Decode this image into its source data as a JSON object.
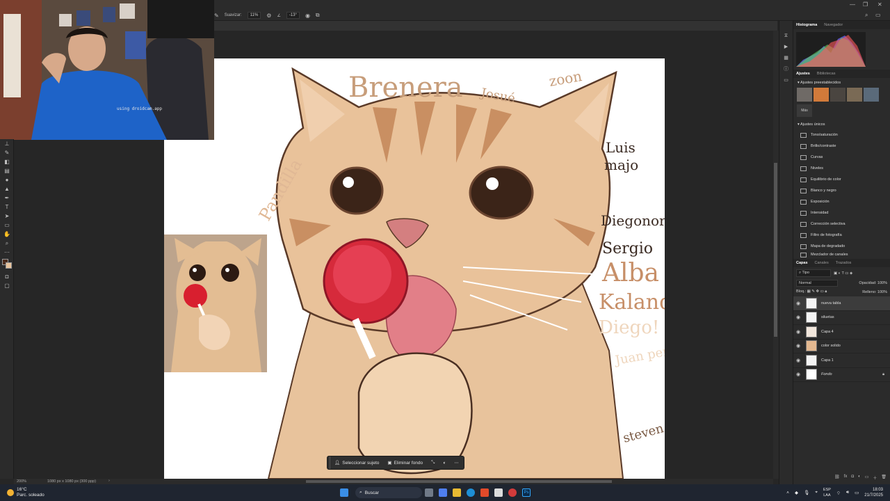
{
  "options_bar": {
    "smooth_label": "Suavizar:",
    "smooth_value": "11%",
    "angle_value": "-13°"
  },
  "adjust_panel": {
    "top_tabs": [
      "Histograma",
      "Navegador"
    ],
    "mid_tabs": [
      "Ajustes",
      "Bibliotecas"
    ],
    "presets_header": "Ajustes preestablecidos",
    "more_label": "Más",
    "single_header": "Ajustes únicos",
    "items": [
      "Tono/saturación",
      "Brillo/contraste",
      "Curvas",
      "Niveles",
      "Equilibrio de color",
      "Blanco y negro",
      "Exposición",
      "Intensidad",
      "Corrección selectiva",
      "Filtro de fotografía",
      "Mapa de degradado",
      "Mezclador de canales"
    ]
  },
  "layers_panel": {
    "tabs": [
      "Capas",
      "Canales",
      "Trazados"
    ],
    "kind_label": "Tipo",
    "blend_mode": "Normal",
    "opacity_label": "Opacidad:",
    "opacity_value": "100%",
    "lock_label": "Bloq.:",
    "fill_label": "Relleno:",
    "fill_value": "100%",
    "layers": [
      "nueva tabla",
      "siluetas",
      "Capa 4",
      "color solido",
      "Capa 1",
      "Fondo"
    ]
  },
  "context_bar": {
    "select_subject": "Seleccionar sujeto",
    "remove_bg": "Eliminar fondo"
  },
  "status_bar": {
    "zoom": "200%",
    "doc_info": "1080 px x 1080 px (300 ppp)"
  },
  "canvas_names": [
    "Brenera",
    "Josué",
    "zoon",
    "Luis",
    "majo",
    "Diegonorro",
    "Sergio",
    "Alba",
    "Kalandro",
    "Diego!",
    "Juan pernas",
    "Pandilla",
    "steven"
  ],
  "webcam": {
    "overlay_text": "using droidcam.app"
  },
  "taskbar": {
    "temperature": "16°C",
    "weather": "Parc. soleado",
    "search": "Buscar",
    "lang": "ESP",
    "lang2": "LAA",
    "time": "18:03",
    "date": "21/7/2025"
  }
}
